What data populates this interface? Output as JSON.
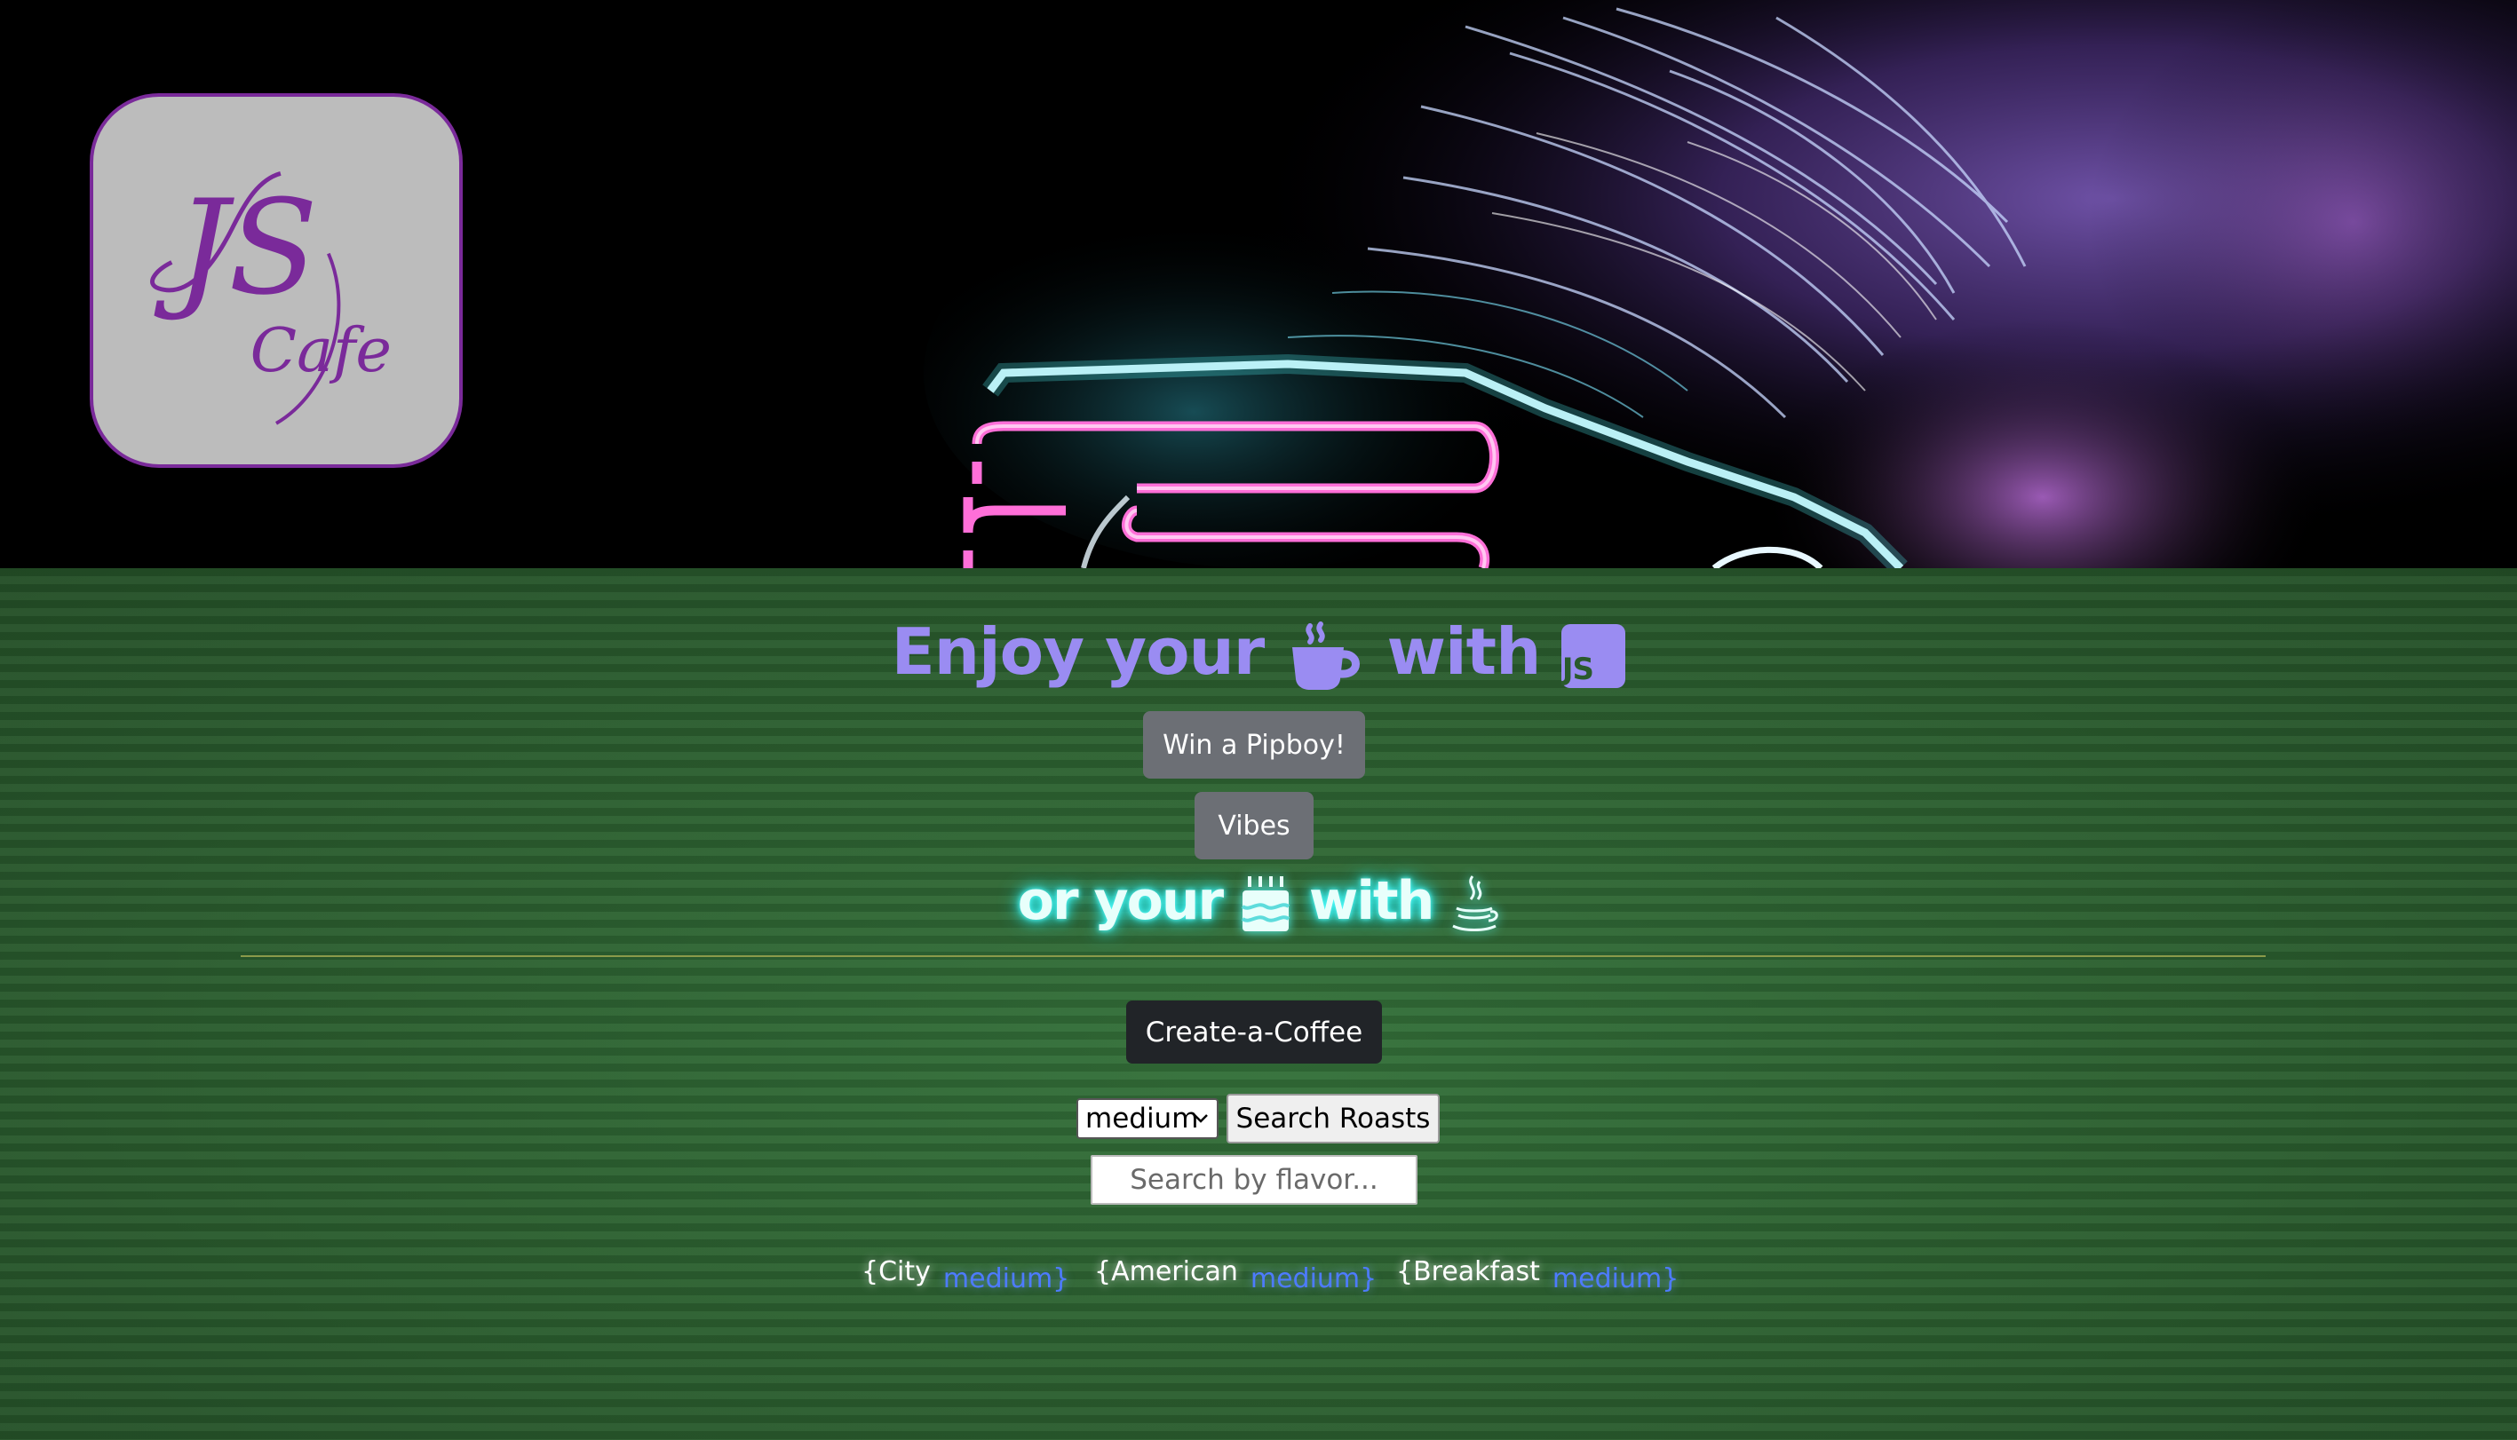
{
  "header": {
    "logo": {
      "line1": "JS",
      "line2": "Cafe",
      "color": "#7a2a9a"
    },
    "banner_icon": "neon-car-art"
  },
  "main": {
    "headline": {
      "part1": "Enjoy your",
      "icon1": "coffee-cup-icon",
      "part2": "with",
      "icon2": "js-badge-icon",
      "badge_text": "JS",
      "color": "#9a8cf2"
    },
    "pipboy_label": "Win a Pipboy!",
    "vibes_label": "Vibes",
    "subline": {
      "part1": "or your",
      "icon1": "cake-icon",
      "part2": "with",
      "icon2": "java-cup-icon"
    },
    "create_label": "Create-a-Coffee",
    "roast_select": {
      "selected": "medium"
    },
    "search_label": "Search Roasts",
    "flavor_placeholder": "Search by flavor...",
    "coffees": [
      {
        "name": "{City",
        "roast": "medium}"
      },
      {
        "name": "{American",
        "roast": "medium}"
      },
      {
        "name": "{Breakfast",
        "roast": "medium}"
      }
    ]
  }
}
